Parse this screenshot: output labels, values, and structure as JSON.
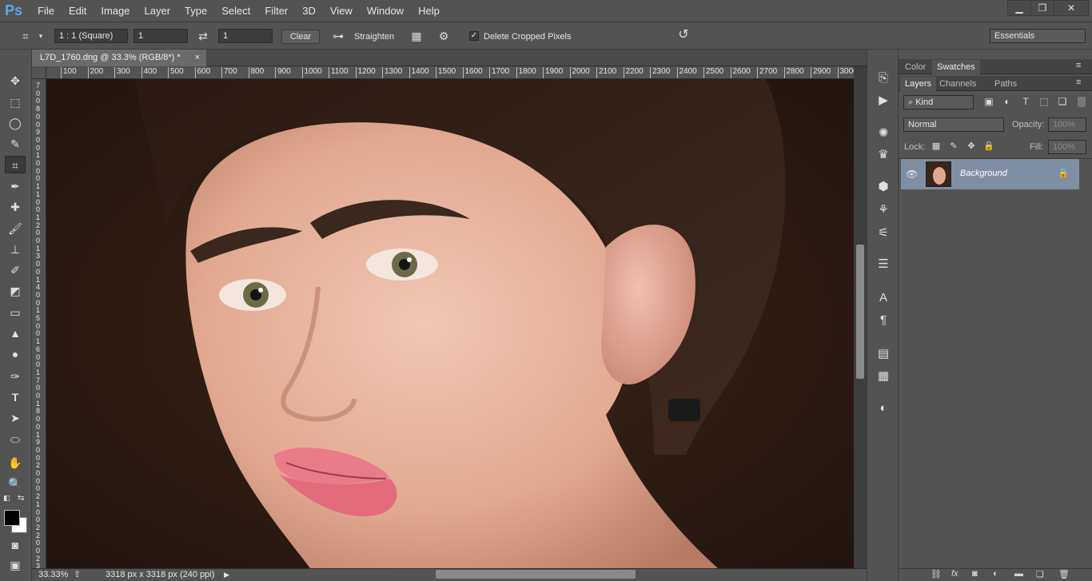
{
  "app": {
    "logo": "Ps"
  },
  "menu": [
    "File",
    "Edit",
    "Image",
    "Layer",
    "Type",
    "Select",
    "Filter",
    "3D",
    "View",
    "Window",
    "Help"
  ],
  "window_controls": {
    "minimize": "▁",
    "restore": "❐",
    "close": "✕"
  },
  "options": {
    "ratio": "1 : 1 (Square)",
    "width": "1",
    "height": "1",
    "clear_label": "Clear",
    "straighten_label": "Straighten",
    "delete_cropped_label": "Delete Cropped Pixels",
    "delete_cropped_checked": true,
    "workspace": "Essentials"
  },
  "document": {
    "tab_title": "L7D_1760.dng @ 33.3% (RGB/8*) *",
    "tab_close": "×",
    "ruler_h": [
      "100",
      "200",
      "300",
      "400",
      "500",
      "600",
      "700",
      "800",
      "900",
      "1000",
      "1100",
      "1200",
      "1300",
      "1400",
      "1500",
      "1600",
      "1700",
      "1800",
      "1900",
      "2000",
      "2100",
      "2200",
      "2300",
      "2400",
      "2500",
      "2600",
      "2700",
      "2800",
      "2900",
      "3000"
    ],
    "ruler_v": [
      "7",
      "0",
      "0",
      "8",
      "0",
      "0",
      "9",
      "0",
      "0",
      "1",
      "0",
      "0",
      "0",
      "1",
      "1",
      "0",
      "0",
      "1",
      "2",
      "0",
      "0",
      "1",
      "3",
      "0",
      "0",
      "1",
      "4",
      "0",
      "0",
      "1",
      "5",
      "0",
      "0",
      "1",
      "6",
      "0",
      "0",
      "1",
      "7",
      "0",
      "0",
      "1",
      "8",
      "0",
      "0",
      "1",
      "9",
      "0",
      "0",
      "2",
      "0",
      "0",
      "0",
      "2",
      "1",
      "0",
      "0",
      "2",
      "2",
      "0",
      "0",
      "2",
      "3"
    ]
  },
  "status": {
    "zoom": "33.33%",
    "doc_info": "3318 px x 3318 px (240 ppi)"
  },
  "panels": {
    "top_tabs": [
      "Color",
      "Swatches"
    ],
    "top_active": "Swatches",
    "layer_tabs": [
      "Layers",
      "Channels",
      "Paths"
    ],
    "layer_active": "Layers",
    "filter_kind": "Kind",
    "blend_mode": "Normal",
    "opacity_label": "Opacity:",
    "opacity_value": "100%",
    "lock_label": "Lock:",
    "fill_label": "Fill:",
    "fill_value": "100%",
    "layers": [
      {
        "name": "Background",
        "visible": true,
        "locked": true
      }
    ],
    "footer_icons": [
      "link-icon",
      "fx-icon",
      "mask-icon",
      "adjustment-icon",
      "folder-icon",
      "new-layer-icon",
      "trash-icon"
    ]
  },
  "colors": {
    "ui_bg": "#535353",
    "panel_dark": "#3c3c3c",
    "accent_logo": "#5ea7e6",
    "selected_layer": "#7f8fa3"
  }
}
